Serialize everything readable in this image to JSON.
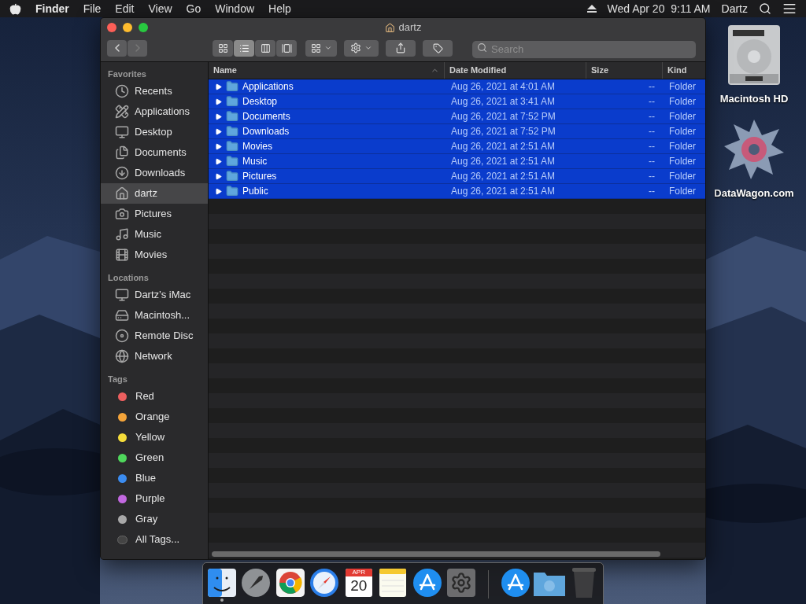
{
  "menu_bar": {
    "app": "Finder",
    "items": [
      "File",
      "Edit",
      "View",
      "Go",
      "Window",
      "Help"
    ],
    "clock": "Wed Apr 20  9:11 AM",
    "user": "Dartz"
  },
  "window": {
    "title": "dartz",
    "back_disabled": false,
    "forward_disabled": true,
    "view_modes": [
      {
        "kind": "icons",
        "selected": false
      },
      {
        "kind": "list",
        "selected": true
      },
      {
        "kind": "columns",
        "selected": false
      },
      {
        "kind": "gallery",
        "selected": false
      }
    ],
    "search": {
      "placeholder": "Search"
    }
  },
  "sidebar": {
    "sections": [
      {
        "title": "Favorites",
        "items": [
          {
            "label": "Recents",
            "kind": "recents",
            "selected": false
          },
          {
            "label": "Applications",
            "kind": "applications",
            "selected": false
          },
          {
            "label": "Desktop",
            "kind": "desktop",
            "selected": false
          },
          {
            "label": "Documents",
            "kind": "documents",
            "selected": false
          },
          {
            "label": "Downloads",
            "kind": "downloads",
            "selected": false
          },
          {
            "label": "dartz",
            "kind": "home",
            "selected": true
          },
          {
            "label": "Pictures",
            "kind": "pictures",
            "selected": false
          },
          {
            "label": "Music",
            "kind": "music",
            "selected": false
          },
          {
            "label": "Movies",
            "kind": "movies",
            "selected": false
          }
        ]
      },
      {
        "title": "Locations",
        "items": [
          {
            "label": "Dartz’s iMac",
            "kind": "computer",
            "selected": false
          },
          {
            "label": "Macintosh...",
            "kind": "disk",
            "selected": false
          },
          {
            "label": "Remote Disc",
            "kind": "disc",
            "selected": false
          },
          {
            "label": "Network",
            "kind": "network",
            "selected": false
          }
        ]
      },
      {
        "title": "Tags",
        "items": [
          {
            "label": "Red",
            "kind": "tag",
            "color": "#ec5f5f",
            "selected": false
          },
          {
            "label": "Orange",
            "kind": "tag",
            "color": "#f4a43a",
            "selected": false
          },
          {
            "label": "Yellow",
            "kind": "tag",
            "color": "#f5dc3a",
            "selected": false
          },
          {
            "label": "Green",
            "kind": "tag",
            "color": "#4fd75c",
            "selected": false
          },
          {
            "label": "Blue",
            "kind": "tag",
            "color": "#3b8cf0",
            "selected": false
          },
          {
            "label": "Purple",
            "kind": "tag",
            "color": "#c268e0",
            "selected": false
          },
          {
            "label": "Gray",
            "kind": "tag",
            "color": "#a8a8a8",
            "selected": false
          },
          {
            "label": "All Tags...",
            "kind": "alltags",
            "selected": false
          }
        ]
      }
    ]
  },
  "table": {
    "columns": [
      "Name",
      "Date Modified",
      "Size",
      "Kind"
    ],
    "rows": [
      {
        "name": "Applications",
        "date": "Aug 26, 2021 at 4:01 AM",
        "size": "--",
        "kind": "Folder",
        "selected": true
      },
      {
        "name": "Desktop",
        "date": "Aug 26, 2021 at 3:41 AM",
        "size": "--",
        "kind": "Folder",
        "selected": true
      },
      {
        "name": "Documents",
        "date": "Aug 26, 2021 at 7:52 PM",
        "size": "--",
        "kind": "Folder",
        "selected": true
      },
      {
        "name": "Downloads",
        "date": "Aug 26, 2021 at 7:52 PM",
        "size": "--",
        "kind": "Folder",
        "selected": true
      },
      {
        "name": "Movies",
        "date": "Aug 26, 2021 at 2:51 AM",
        "size": "--",
        "kind": "Folder",
        "selected": true
      },
      {
        "name": "Music",
        "date": "Aug 26, 2021 at 2:51 AM",
        "size": "--",
        "kind": "Folder",
        "selected": true
      },
      {
        "name": "Pictures",
        "date": "Aug 26, 2021 at 2:51 AM",
        "size": "--",
        "kind": "Folder",
        "selected": true
      },
      {
        "name": "Public",
        "date": "Aug 26, 2021 at 2:51 AM",
        "size": "--",
        "kind": "Folder",
        "selected": true
      }
    ]
  },
  "desktop_icons": [
    {
      "label": "Macintosh HD",
      "kind": "drive"
    },
    {
      "label": "DataWagon.com",
      "kind": "emblem"
    }
  ],
  "dock": {
    "items": [
      {
        "kind": "finder",
        "running": true
      },
      {
        "kind": "launchpad",
        "running": false
      },
      {
        "kind": "chrome",
        "running": false
      },
      {
        "kind": "safari",
        "running": false
      },
      {
        "kind": "calendar",
        "month": "APR",
        "day": "20",
        "running": false
      },
      {
        "kind": "notes",
        "running": false
      },
      {
        "kind": "appstore",
        "running": false
      },
      {
        "kind": "settings",
        "running": false
      },
      {
        "kind": "separator"
      },
      {
        "kind": "appstore",
        "running": false
      },
      {
        "kind": "downloads",
        "running": false
      },
      {
        "kind": "trash",
        "running": false
      }
    ]
  }
}
